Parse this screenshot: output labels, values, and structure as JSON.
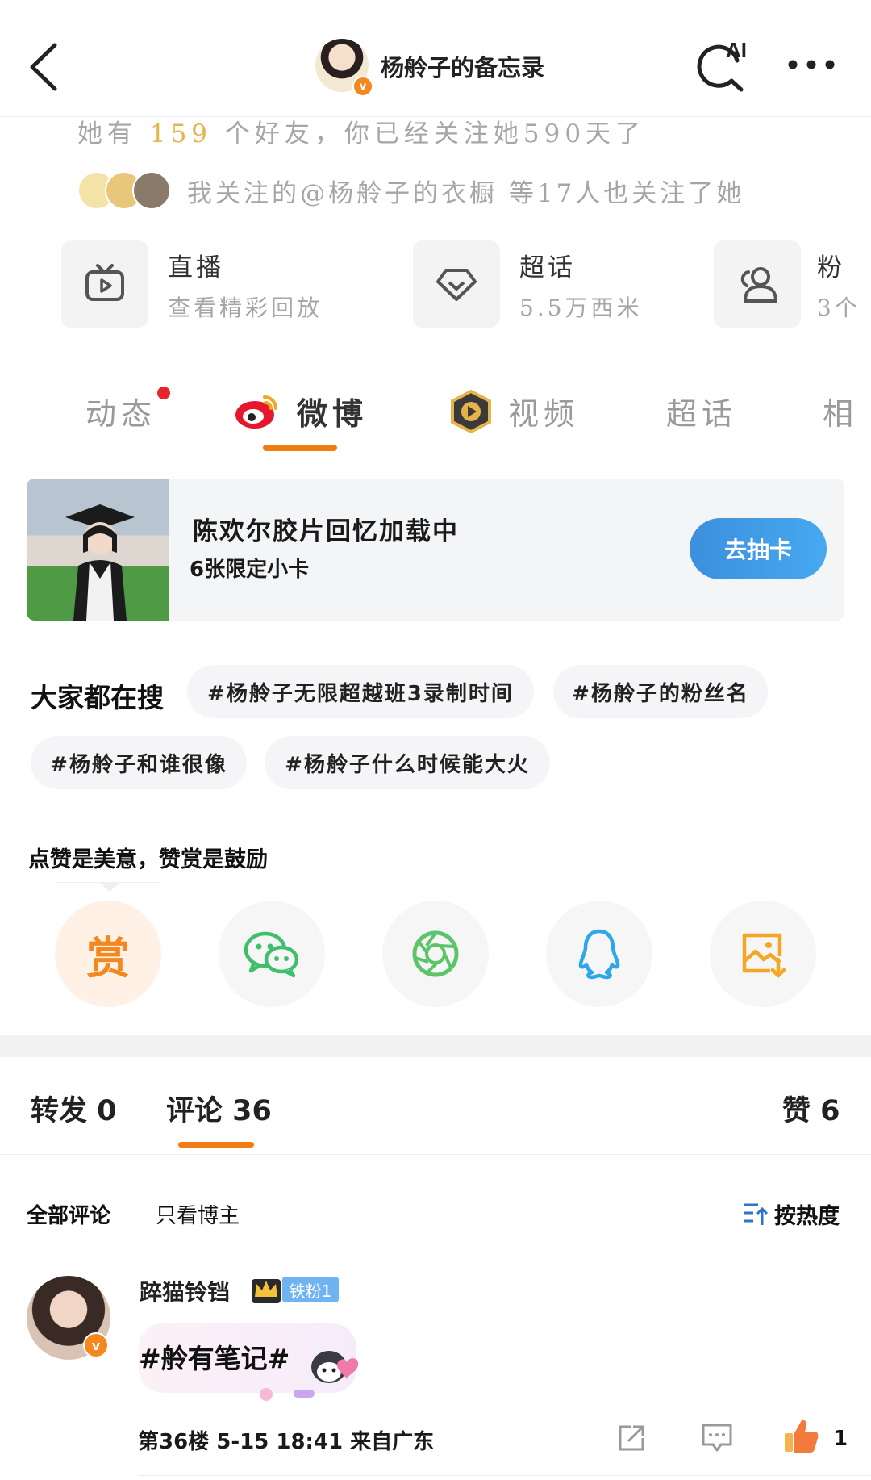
{
  "header": {
    "title": "杨舲子的备忘录",
    "avatar_badge": "v",
    "ai_label": "AI",
    "icons": [
      "back-icon",
      "ai-search-icon",
      "more-icon"
    ]
  },
  "profile": {
    "friends_prefix": "她有",
    "friends_count": "159",
    "friends_suffix": "个好友，你已经关注她590天了",
    "mutual_text": "我关注的@杨舲子的衣橱 等17人也关注了她"
  },
  "features": [
    {
      "icon": "tv-icon",
      "name": "直播",
      "sub": "查看精彩回放"
    },
    {
      "icon": "diamond-icon",
      "name": "超话",
      "sub": "5.5万西米"
    },
    {
      "icon": "users-icon",
      "name": "粉",
      "sub": "3个"
    }
  ],
  "tabs": [
    "动态",
    "微博",
    "视频",
    "超话",
    "相"
  ],
  "active_tab": "微博",
  "banner": {
    "title": "陈欢尔胶片回忆加载中",
    "subtitle": "6张限定小卡",
    "button": "去抽卡"
  },
  "search": {
    "label": "大家都在搜",
    "chips": [
      "#杨舲子无限超越班3录制时间",
      "#杨舲子的粉丝名",
      "#杨舲子和谁很像",
      "#杨舲子什么时候能大火"
    ]
  },
  "share": {
    "label": "点赞是美意，赞赏是鼓励",
    "reward": "赏",
    "items": [
      "reward-icon",
      "wechat-icon",
      "moments-icon",
      "qq-icon",
      "save-image-icon"
    ]
  },
  "comment_tabs": {
    "repost": "转发 0",
    "comments": "评论 36",
    "likes": "赞 6"
  },
  "filters": {
    "all": "全部评论",
    "owner_only": "只看博主",
    "sort": "按热度"
  },
  "comment": {
    "user": "踤猫铃铛",
    "badge": "铁粉1",
    "avatar_badge": "v",
    "text": "#舲有笔记#",
    "meta": "第36楼 5-15 18:41 来自广东",
    "like_count": "1"
  },
  "colors": {
    "accent": "#f07c12",
    "button_blue": "#3c8fdc",
    "highlight_gold": "#e2b64e",
    "text_gray": "#a6a6a6"
  }
}
